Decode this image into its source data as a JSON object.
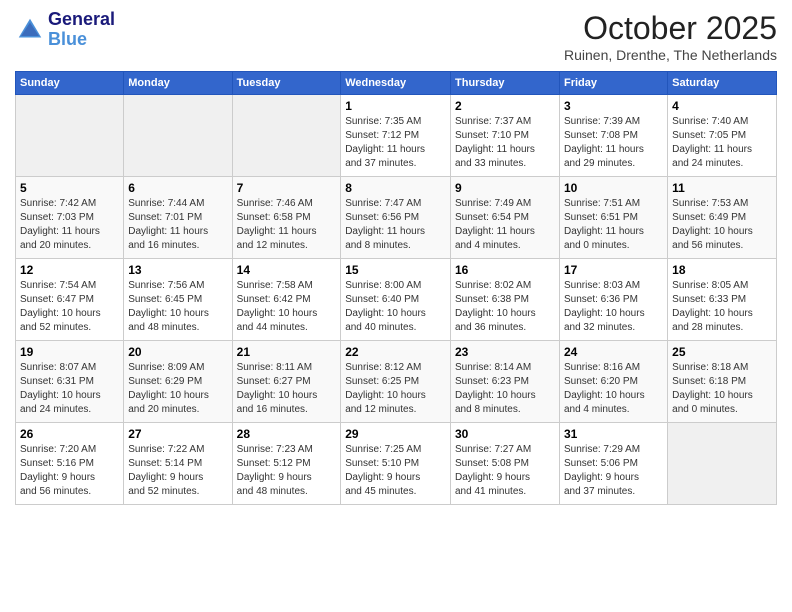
{
  "logo": {
    "line1": "General",
    "line2": "Blue"
  },
  "title": "October 2025",
  "location": "Ruinen, Drenthe, The Netherlands",
  "days_of_week": [
    "Sunday",
    "Monday",
    "Tuesday",
    "Wednesday",
    "Thursday",
    "Friday",
    "Saturday"
  ],
  "weeks": [
    [
      {
        "day": "",
        "info": ""
      },
      {
        "day": "",
        "info": ""
      },
      {
        "day": "",
        "info": ""
      },
      {
        "day": "1",
        "info": "Sunrise: 7:35 AM\nSunset: 7:12 PM\nDaylight: 11 hours\nand 37 minutes."
      },
      {
        "day": "2",
        "info": "Sunrise: 7:37 AM\nSunset: 7:10 PM\nDaylight: 11 hours\nand 33 minutes."
      },
      {
        "day": "3",
        "info": "Sunrise: 7:39 AM\nSunset: 7:08 PM\nDaylight: 11 hours\nand 29 minutes."
      },
      {
        "day": "4",
        "info": "Sunrise: 7:40 AM\nSunset: 7:05 PM\nDaylight: 11 hours\nand 24 minutes."
      }
    ],
    [
      {
        "day": "5",
        "info": "Sunrise: 7:42 AM\nSunset: 7:03 PM\nDaylight: 11 hours\nand 20 minutes."
      },
      {
        "day": "6",
        "info": "Sunrise: 7:44 AM\nSunset: 7:01 PM\nDaylight: 11 hours\nand 16 minutes."
      },
      {
        "day": "7",
        "info": "Sunrise: 7:46 AM\nSunset: 6:58 PM\nDaylight: 11 hours\nand 12 minutes."
      },
      {
        "day": "8",
        "info": "Sunrise: 7:47 AM\nSunset: 6:56 PM\nDaylight: 11 hours\nand 8 minutes."
      },
      {
        "day": "9",
        "info": "Sunrise: 7:49 AM\nSunset: 6:54 PM\nDaylight: 11 hours\nand 4 minutes."
      },
      {
        "day": "10",
        "info": "Sunrise: 7:51 AM\nSunset: 6:51 PM\nDaylight: 11 hours\nand 0 minutes."
      },
      {
        "day": "11",
        "info": "Sunrise: 7:53 AM\nSunset: 6:49 PM\nDaylight: 10 hours\nand 56 minutes."
      }
    ],
    [
      {
        "day": "12",
        "info": "Sunrise: 7:54 AM\nSunset: 6:47 PM\nDaylight: 10 hours\nand 52 minutes."
      },
      {
        "day": "13",
        "info": "Sunrise: 7:56 AM\nSunset: 6:45 PM\nDaylight: 10 hours\nand 48 minutes."
      },
      {
        "day": "14",
        "info": "Sunrise: 7:58 AM\nSunset: 6:42 PM\nDaylight: 10 hours\nand 44 minutes."
      },
      {
        "day": "15",
        "info": "Sunrise: 8:00 AM\nSunset: 6:40 PM\nDaylight: 10 hours\nand 40 minutes."
      },
      {
        "day": "16",
        "info": "Sunrise: 8:02 AM\nSunset: 6:38 PM\nDaylight: 10 hours\nand 36 minutes."
      },
      {
        "day": "17",
        "info": "Sunrise: 8:03 AM\nSunset: 6:36 PM\nDaylight: 10 hours\nand 32 minutes."
      },
      {
        "day": "18",
        "info": "Sunrise: 8:05 AM\nSunset: 6:33 PM\nDaylight: 10 hours\nand 28 minutes."
      }
    ],
    [
      {
        "day": "19",
        "info": "Sunrise: 8:07 AM\nSunset: 6:31 PM\nDaylight: 10 hours\nand 24 minutes."
      },
      {
        "day": "20",
        "info": "Sunrise: 8:09 AM\nSunset: 6:29 PM\nDaylight: 10 hours\nand 20 minutes."
      },
      {
        "day": "21",
        "info": "Sunrise: 8:11 AM\nSunset: 6:27 PM\nDaylight: 10 hours\nand 16 minutes."
      },
      {
        "day": "22",
        "info": "Sunrise: 8:12 AM\nSunset: 6:25 PM\nDaylight: 10 hours\nand 12 minutes."
      },
      {
        "day": "23",
        "info": "Sunrise: 8:14 AM\nSunset: 6:23 PM\nDaylight: 10 hours\nand 8 minutes."
      },
      {
        "day": "24",
        "info": "Sunrise: 8:16 AM\nSunset: 6:20 PM\nDaylight: 10 hours\nand 4 minutes."
      },
      {
        "day": "25",
        "info": "Sunrise: 8:18 AM\nSunset: 6:18 PM\nDaylight: 10 hours\nand 0 minutes."
      }
    ],
    [
      {
        "day": "26",
        "info": "Sunrise: 7:20 AM\nSunset: 5:16 PM\nDaylight: 9 hours\nand 56 minutes."
      },
      {
        "day": "27",
        "info": "Sunrise: 7:22 AM\nSunset: 5:14 PM\nDaylight: 9 hours\nand 52 minutes."
      },
      {
        "day": "28",
        "info": "Sunrise: 7:23 AM\nSunset: 5:12 PM\nDaylight: 9 hours\nand 48 minutes."
      },
      {
        "day": "29",
        "info": "Sunrise: 7:25 AM\nSunset: 5:10 PM\nDaylight: 9 hours\nand 45 minutes."
      },
      {
        "day": "30",
        "info": "Sunrise: 7:27 AM\nSunset: 5:08 PM\nDaylight: 9 hours\nand 41 minutes."
      },
      {
        "day": "31",
        "info": "Sunrise: 7:29 AM\nSunset: 5:06 PM\nDaylight: 9 hours\nand 37 minutes."
      },
      {
        "day": "",
        "info": ""
      }
    ]
  ]
}
